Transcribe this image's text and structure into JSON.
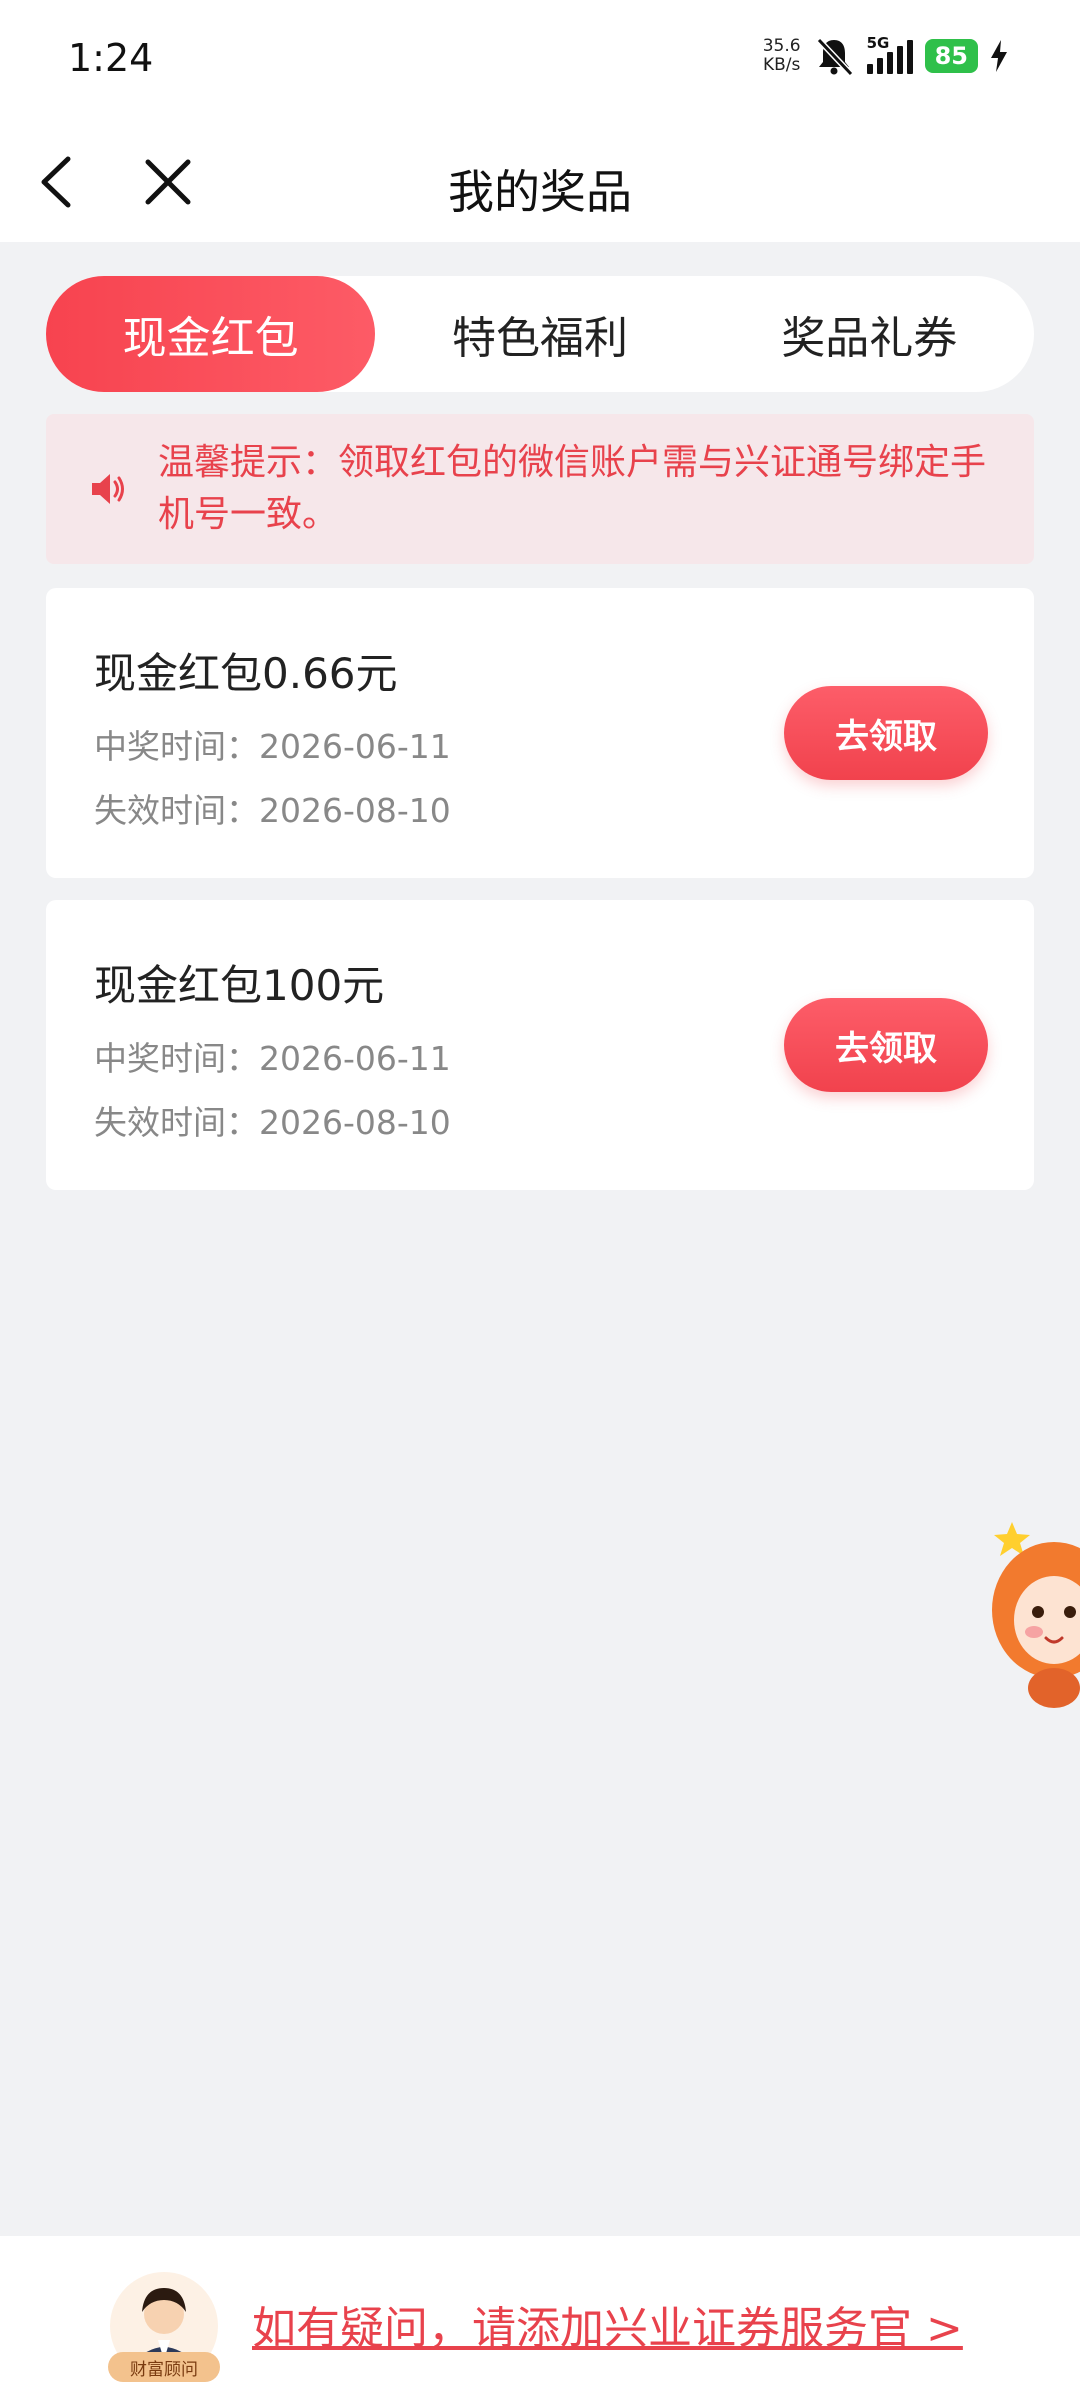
{
  "status_bar": {
    "time": "1:24",
    "net_speed_value": "35.6",
    "net_speed_unit": "KB/s",
    "network": "5G",
    "battery": "85",
    "icons": [
      "mute-bell-icon",
      "signal-icon",
      "battery-icon",
      "charging-icon"
    ]
  },
  "header": {
    "title": "我的奖品",
    "icons": [
      "back-arrow-icon",
      "close-icon"
    ]
  },
  "tabs": [
    {
      "label": "现金红包",
      "active": true
    },
    {
      "label": "特色福利",
      "active": false
    },
    {
      "label": "奖品礼券",
      "active": false
    }
  ],
  "notice": {
    "text": "温馨提示：领取红包的微信账户需与兴证通号绑定手机号一致。",
    "icon": "speaker-icon"
  },
  "prizes": [
    {
      "title": "现金红包0.66元",
      "win_time": "中奖时间：2026-06-11",
      "expire_time": "失效时间：2026-08-10",
      "button": "去领取"
    },
    {
      "title": "现金红包100元",
      "win_time": "中奖时间：2026-06-11",
      "expire_time": "失效时间：2026-08-10",
      "button": "去领取"
    }
  ],
  "footer": {
    "advisor_label": "财富顾问",
    "link": "如有疑问，请添加兴业证券服务官 >"
  },
  "colors": {
    "accent": "#f7434f",
    "notice_bg": "#f6e7ea",
    "page_bg": "#f1f2f4"
  }
}
